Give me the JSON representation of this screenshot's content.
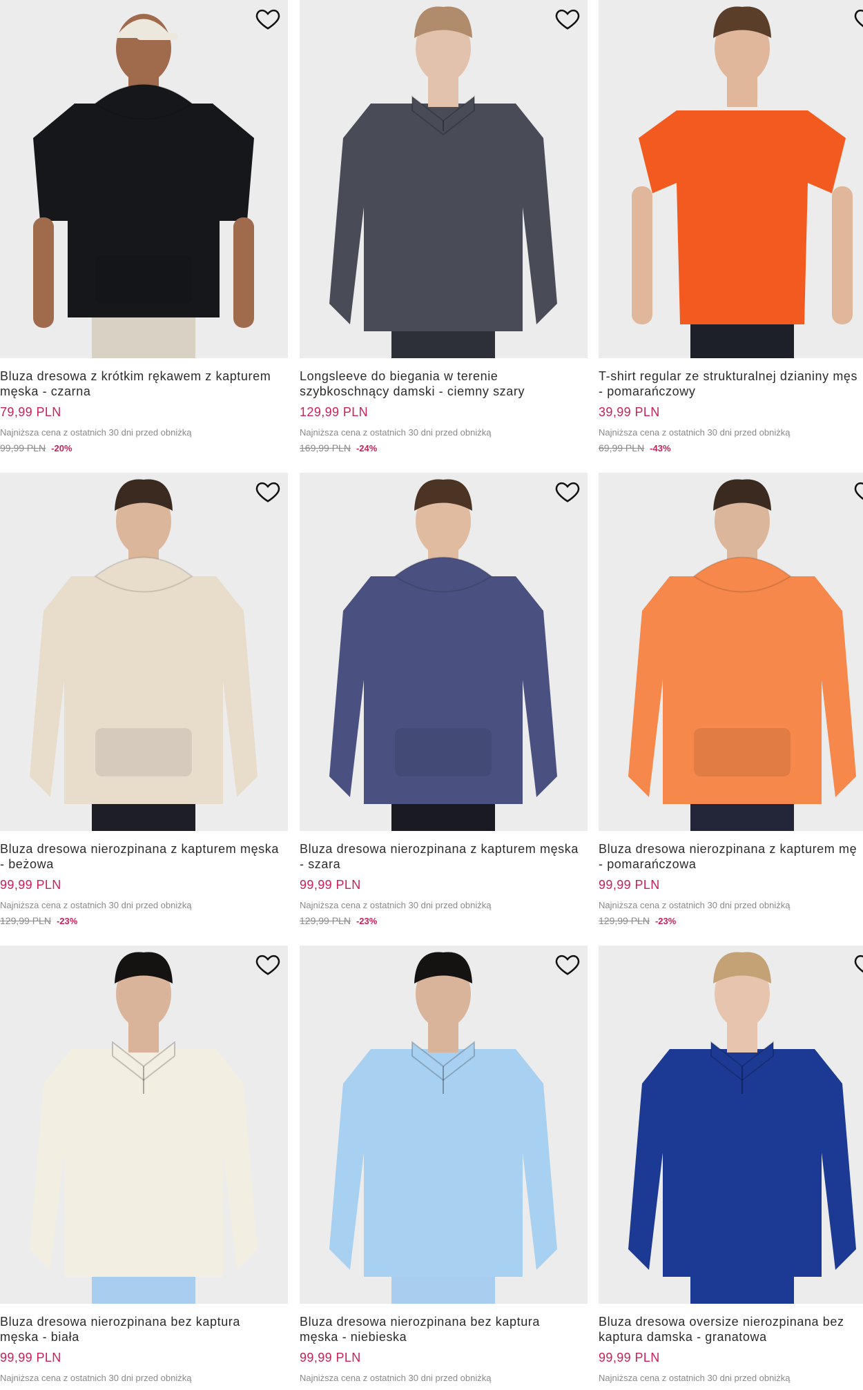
{
  "products": [
    {
      "title": "Bluza dresowa z krótkim rękawem z kapturem",
      "title2": "męska - czarna",
      "price": "79,99 PLN",
      "lowest_label": "Najniższa cena z ostatnich 30 dni przed obniżką",
      "old_price": "99,99 PLN",
      "discount": "-20%",
      "colors": {
        "garment": "#16171b",
        "skin": "#a06a4d",
        "pants": "#d9d2c4",
        "hat": "#ece8dd",
        "hair": "#1b1410"
      },
      "style": "hoodie-short"
    },
    {
      "title": "Longsleeve do biegania w terenie",
      "title2": "szybkoschnący damski - ciemny szary",
      "price": "129,99 PLN",
      "lowest_label": "Najniższa cena z ostatnich 30 dni przed obniżką",
      "old_price": "169,99 PLN",
      "discount": "-24%",
      "colors": {
        "garment": "#494c56",
        "skin": "#e2c2ad",
        "pants": "#2e3039",
        "hair": "#b08c6c"
      },
      "style": "longsleeve"
    },
    {
      "title": "T-shirt regular ze strukturalnej dzianiny męs",
      "title2": "- pomarańczowy",
      "price": "39,99 PLN",
      "lowest_label": "Najniższa cena z ostatnich 30 dni przed obniżką",
      "old_price": "69,99 PLN",
      "discount": "-43%",
      "colors": {
        "garment": "#f35a1f",
        "skin": "#e0b79b",
        "pants": "#1d1f29",
        "hair": "#5a3e2a"
      },
      "style": "tshirt"
    },
    {
      "title": "Bluza dresowa nierozpinana z kapturem męska",
      "title2": "- beżowa",
      "price": "99,99 PLN",
      "lowest_label": "Najniższa cena z ostatnich 30 dni przed obniżką",
      "old_price": "129,99 PLN",
      "discount": "-23%",
      "colors": {
        "garment": "#e8dccb",
        "skin": "#dcb69b",
        "pants": "#1e1f26",
        "hair": "#3a2a20"
      },
      "style": "hoodie"
    },
    {
      "title": "Bluza dresowa nierozpinana z kapturem męska",
      "title2": "- szara",
      "price": "99,99 PLN",
      "lowest_label": "Najniższa cena z ostatnich 30 dni przed obniżką",
      "old_price": "129,99 PLN",
      "discount": "-23%",
      "colors": {
        "garment": "#4a5180",
        "skin": "#e0bba0",
        "pants": "#1a1b22",
        "hair": "#4b3424"
      },
      "style": "hoodie"
    },
    {
      "title": "Bluza dresowa nierozpinana z kapturem mę",
      "title2": "- pomarańczowa",
      "price": "99,99 PLN",
      "lowest_label": "Najniższa cena z ostatnich 30 dni przed obniżką",
      "old_price": "129,99 PLN",
      "discount": "-23%",
      "colors": {
        "garment": "#f5884a",
        "skin": "#dcb69b",
        "pants": "#232538",
        "hair": "#3a2a20"
      },
      "style": "hoodie"
    },
    {
      "title": "Bluza dresowa nierozpinana bez kaptura",
      "title2": "męska - biała",
      "price": "99,99 PLN",
      "lowest_label": "Najniższa cena z ostatnich 30 dni przed obniżką",
      "old_price": "",
      "discount": "",
      "colors": {
        "garment": "#f3eee2",
        "skin": "#dab49a",
        "pants": "#a9cdee",
        "hair": "#151212"
      },
      "style": "zipneck"
    },
    {
      "title": "Bluza dresowa nierozpinana bez kaptura",
      "title2": "męska - niebieska",
      "price": "99,99 PLN",
      "lowest_label": "Najniższa cena z ostatnich 30 dni przed obniżką",
      "old_price": "",
      "discount": "",
      "colors": {
        "garment": "#a8d0f0",
        "skin": "#dab49a",
        "pants": "#a9cdee",
        "hair": "#151212"
      },
      "style": "zipneck"
    },
    {
      "title": "Bluza dresowa oversize nierozpinana bez",
      "title2": "kaptura damska - granatowa",
      "price": "99,99 PLN",
      "lowest_label": "Najniższa cena z ostatnich 30 dni przed obniżką",
      "old_price": "",
      "discount": "",
      "colors": {
        "garment": "#1c3a94",
        "skin": "#e6c4ad",
        "pants": "#1c3a94",
        "hair": "#c4a276"
      },
      "style": "zipneck-w"
    }
  ],
  "icons": {
    "wishlist": "heart-outline-icon"
  }
}
